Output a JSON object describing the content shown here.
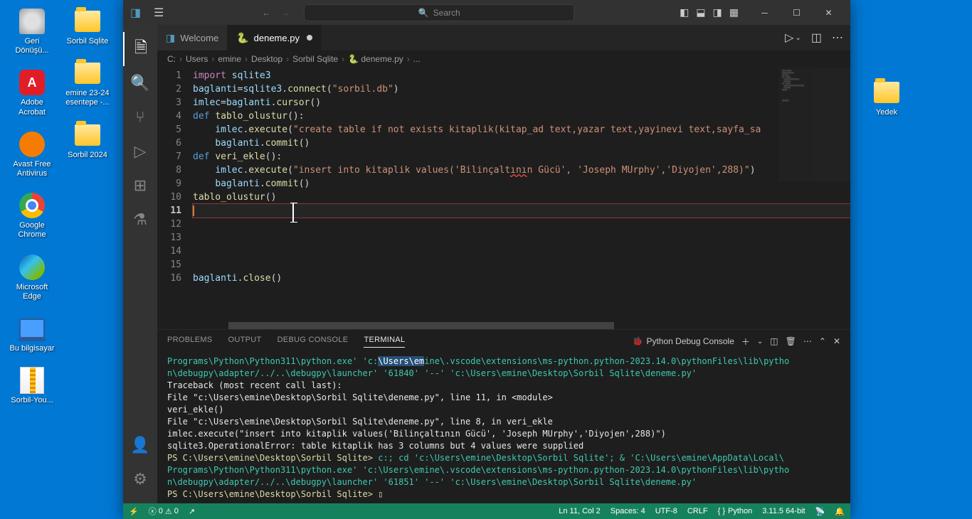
{
  "desktop": {
    "left": [
      {
        "label": "Geri Dönüşü...",
        "icon": "recycle"
      },
      {
        "label": "Adobe Acrobat",
        "icon": "adobe"
      },
      {
        "label": "Avast Free Antivirus",
        "icon": "avast"
      },
      {
        "label": "Google Chrome",
        "icon": "chrome"
      },
      {
        "label": "Microsoft Edge",
        "icon": "edge"
      },
      {
        "label": "Bu bilgisayar",
        "icon": "pc"
      },
      {
        "label": "Sorbil-You...",
        "icon": "zip"
      }
    ],
    "mid": [
      {
        "label": "Sorbil Sqlite",
        "icon": "folder"
      },
      {
        "label": "emine 23-24 esentepe -...",
        "icon": "folder"
      },
      {
        "label": "Sorbil 2024",
        "icon": "folder"
      }
    ],
    "right": [
      {
        "label": "Yedek",
        "icon": "folder"
      }
    ]
  },
  "titlebar": {
    "search_placeholder": "Search"
  },
  "tabs": [
    {
      "label": "Welcome",
      "icon": "vscode",
      "dirty": false
    },
    {
      "label": "deneme.py",
      "icon": "python",
      "dirty": true,
      "active": true
    }
  ],
  "breadcrumbs": [
    "C:",
    "Users",
    "emine",
    "Desktop",
    "Sorbil Sqlite",
    "deneme.py",
    "..."
  ],
  "code": {
    "lines": [
      {
        "n": 1,
        "html": "<span class='kw'>import</span> <span class='var'>sqlite3</span>"
      },
      {
        "n": 2,
        "html": "<span class='var'>baglanti</span><span class='plain'>=</span><span class='var'>sqlite3</span><span class='plain'>.</span><span class='fn'>connect</span><span class='plain'>(</span><span class='str'>\"sorbil.db\"</span><span class='plain'>)</span>"
      },
      {
        "n": 3,
        "html": "<span class='var'>imlec</span><span class='plain'>=</span><span class='var'>baglanti</span><span class='plain'>.</span><span class='fn'>cursor</span><span class='plain'>()</span>"
      },
      {
        "n": 4,
        "html": "<span class='def'>def</span> <span class='fn'>tablo_olustur</span><span class='plain'>():</span>"
      },
      {
        "n": 5,
        "html": "    <span class='var'>imlec</span><span class='plain'>.</span><span class='fn'>execute</span><span class='plain'>(</span><span class='str'>\"create table if not exists kitaplik(kitap_ad text,yazar text,yayinevi text,sayfa_sa</span>"
      },
      {
        "n": 6,
        "html": "    <span class='var'>baglanti</span><span class='plain'>.</span><span class='fn'>commit</span><span class='plain'>()</span>"
      },
      {
        "n": 7,
        "html": "<span class='def'>def</span> <span class='fn'>veri_ekle</span><span class='plain'>():</span>"
      },
      {
        "n": 8,
        "html": "    <span class='var'>imlec</span><span class='plain'>.</span><span class='fn'>execute</span><span class='plain'>(</span><span class='str'>\"insert into kitaplik values('Bilinçalt<span class='squiggly'>ını</span>n Gücü', 'Joseph MUrphy','Diyojen',288)\"</span><span class='plain'>)</span>"
      },
      {
        "n": 9,
        "html": "    <span class='var'>baglanti</span><span class='plain'>.</span><span class='fn'>commit</span><span class='plain'>()</span>"
      },
      {
        "n": 10,
        "html": "<span class='fn'>tablo_olustur</span><span class='plain'>()</span>"
      },
      {
        "n": 11,
        "html": "<span class='plain'></span><span class='cursor'></span>",
        "current": true
      },
      {
        "n": 12,
        "html": ""
      },
      {
        "n": 13,
        "html": ""
      },
      {
        "n": 14,
        "html": ""
      },
      {
        "n": 15,
        "html": ""
      },
      {
        "n": 16,
        "html": "<span class='var'>baglanti</span><span class='plain'>.</span><span class='fn'>close</span><span class='plain'>()</span>"
      }
    ]
  },
  "panel": {
    "tabs": [
      "PROBLEMS",
      "OUTPUT",
      "DEBUG CONSOLE",
      "TERMINAL"
    ],
    "active_tab": "TERMINAL",
    "dropdown": "Python Debug Console",
    "lines": [
      {
        "cls": "t-cyan",
        "text": "Programs\\Python\\Python311\\python.exe' 'c:\\Users\\emine\\.vscode\\extensions\\ms-python.python-2023.14.0\\pythonFiles\\lib\\pytho",
        "sel": "\\Users\\em"
      },
      {
        "cls": "t-cyan",
        "text": "n\\debugpy\\adapter/../..\\debugpy\\launcher' '61840' '--' 'c:\\Users\\emine\\Desktop\\Sorbil Sqlite\\deneme.py'"
      },
      {
        "cls": "t-white",
        "text": "Traceback (most recent call last):"
      },
      {
        "cls": "t-white",
        "text": "  File \"c:\\Users\\emine\\Desktop\\Sorbil Sqlite\\deneme.py\", line 11, in <module>"
      },
      {
        "cls": "t-white",
        "text": "    veri_ekle()"
      },
      {
        "cls": "t-white",
        "text": "  File \"c:\\Users\\emine\\Desktop\\Sorbil Sqlite\\deneme.py\", line 8, in veri_ekle"
      },
      {
        "cls": "t-white",
        "text": "    imlec.execute(\"insert into kitaplik values('Bilinçaltının Gücü', 'Joseph MUrphy','Diyojen',288)\")"
      },
      {
        "cls": "t-white",
        "text": "sqlite3.OperationalError: table kitaplik has 3 columns but 4 values were supplied"
      },
      {
        "cls": "mix",
        "pre": "PS C:\\Users\\emine\\Desktop\\Sorbil Sqlite> ",
        "cmd": "c:; cd 'c:\\Users\\emine\\Desktop\\Sorbil Sqlite'; & 'C:\\Users\\emine\\AppData\\Local\\"
      },
      {
        "cls": "t-cyan",
        "text": "Programs\\Python\\Python311\\python.exe' 'c:\\Users\\emine\\.vscode\\extensions\\ms-python.python-2023.14.0\\pythonFiles\\lib\\pytho"
      },
      {
        "cls": "t-cyan",
        "text": "n\\debugpy\\adapter/../..\\debugpy\\launcher' '61851' '--' 'c:\\Users\\emine\\Desktop\\Sorbil Sqlite\\deneme.py'"
      },
      {
        "cls": "t-yellow",
        "text": "PS C:\\Users\\emine\\Desktop\\Sorbil Sqlite> ▯"
      }
    ]
  },
  "statusbar": {
    "errors": "0",
    "warnings": "0",
    "position": "Ln 11, Col 2",
    "spaces": "Spaces: 4",
    "encoding": "UTF-8",
    "eol": "CRLF",
    "language": "Python",
    "version": "3.11.5 64-bit"
  }
}
